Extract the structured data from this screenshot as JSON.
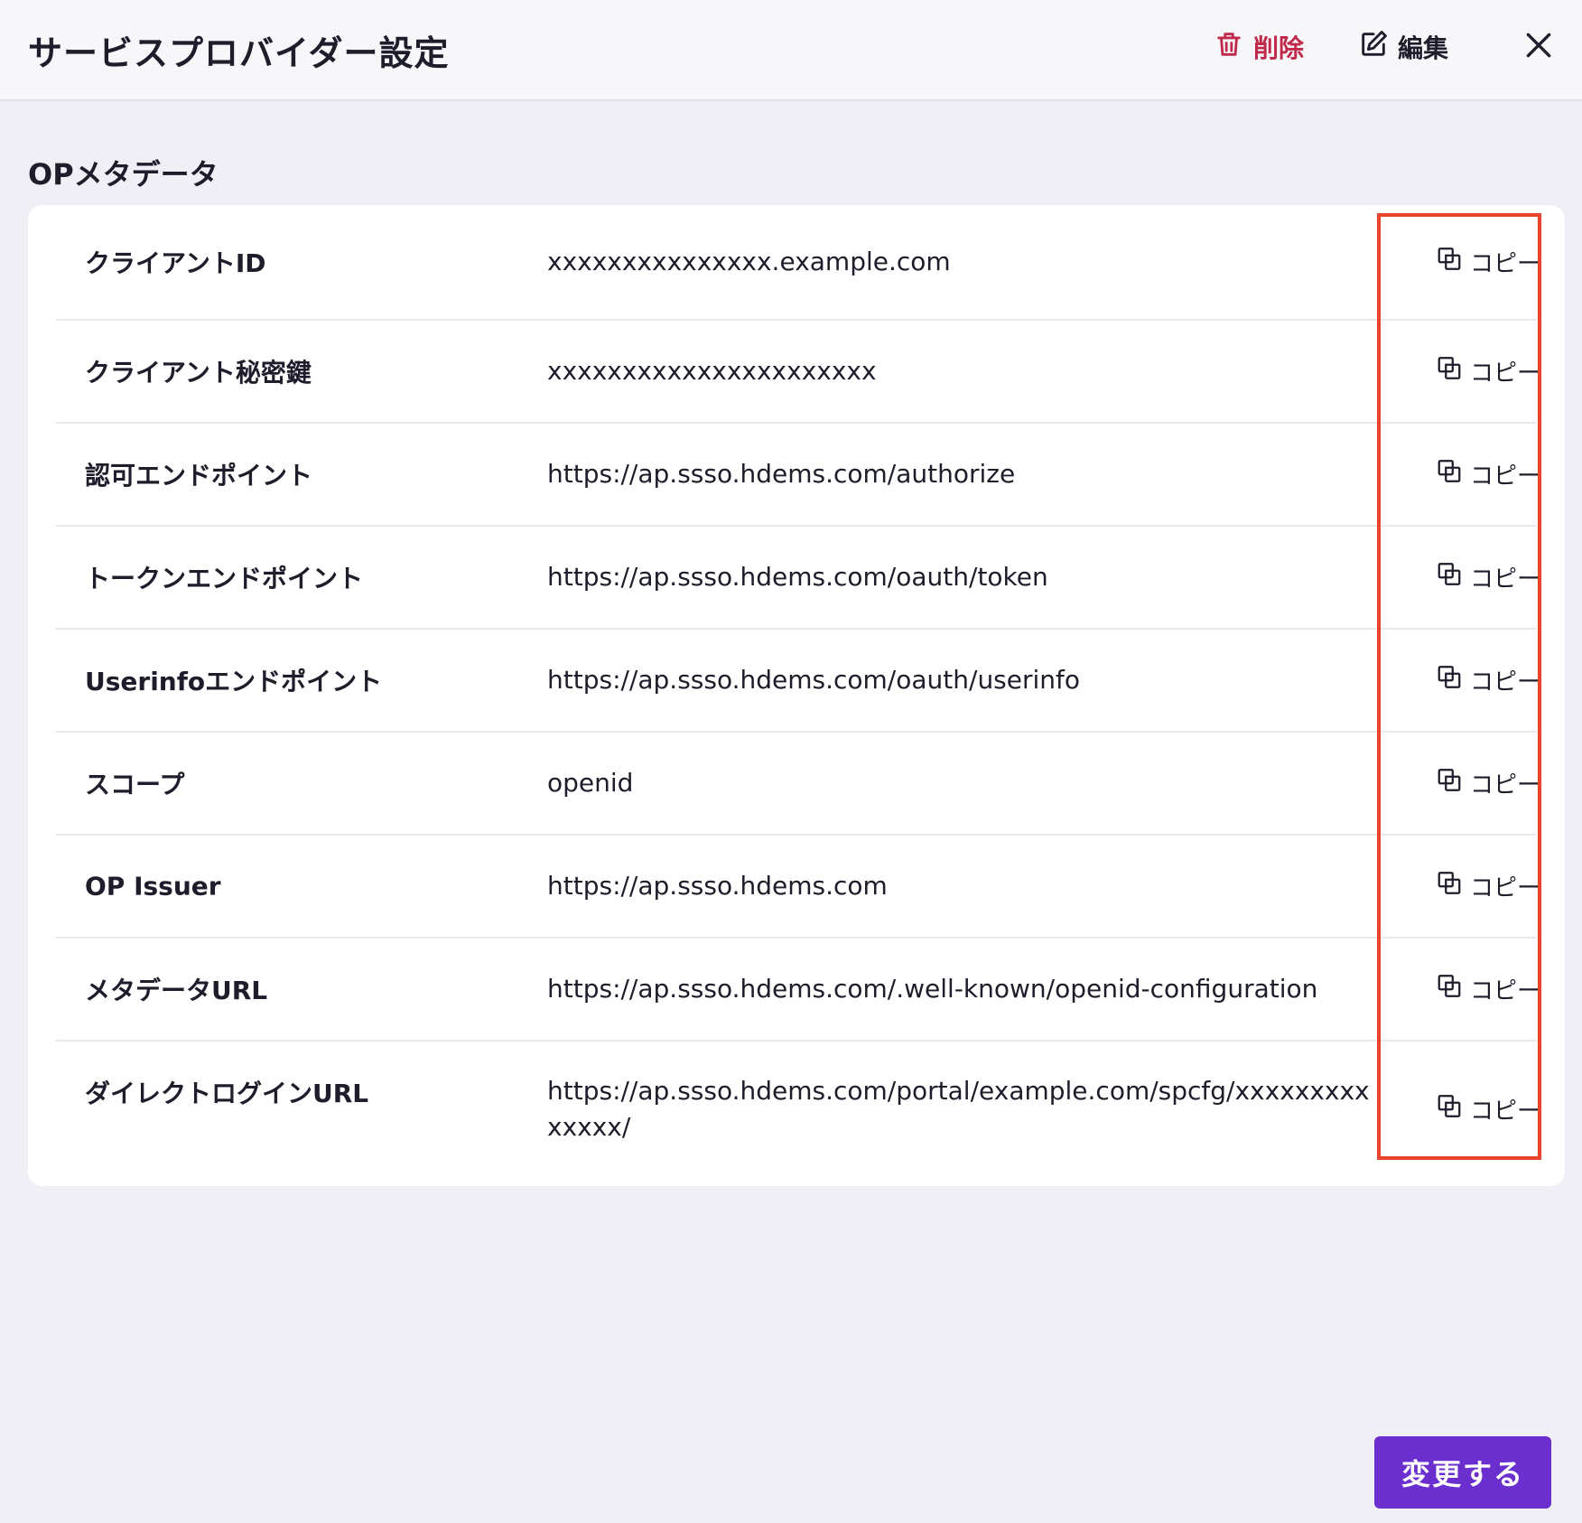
{
  "header": {
    "title": "サービスプロバイダー設定",
    "delete_label": "削除",
    "edit_label": "編集"
  },
  "section": {
    "title": "OPメタデータ"
  },
  "rows": [
    {
      "label": "クライアントID",
      "value": "xxxxxxxxxxxxxxx.example.com",
      "copy_label": "コピー"
    },
    {
      "label": "クライアント秘密鍵",
      "value": "xxxxxxxxxxxxxxxxxxxxxx",
      "copy_label": "コピー"
    },
    {
      "label": "認可エンドポイント",
      "value": "https://ap.ssso.hdems.com/authorize",
      "copy_label": "コピー"
    },
    {
      "label": "トークンエンドポイント",
      "value": "https://ap.ssso.hdems.com/oauth/token",
      "copy_label": "コピー"
    },
    {
      "label": "Userinfoエンドポイント",
      "value": "https://ap.ssso.hdems.com/oauth/userinfo",
      "copy_label": "コピー"
    },
    {
      "label": "スコープ",
      "value": "openid",
      "copy_label": "コピー"
    },
    {
      "label": "OP Issuer",
      "value": "https://ap.ssso.hdems.com",
      "copy_label": "コピー"
    },
    {
      "label": "メタデータURL",
      "value": "https://ap.ssso.hdems.com/.well-known/openid-configuration",
      "copy_label": "コピー"
    },
    {
      "label": "ダイレクトログインURL",
      "value": "https://ap.ssso.hdems.com/portal/example.com/spcfg/xxxxxxxxxxxxxx/",
      "copy_label": "コピー"
    }
  ],
  "footer": {
    "submit_label": "変更する"
  },
  "colors": {
    "accent": "#6c2fcf",
    "danger": "#c02a4a",
    "highlight": "#e8442a"
  },
  "icons": {
    "delete": "trash-icon",
    "edit": "edit-icon",
    "close": "close-icon",
    "copy": "copy-icon"
  }
}
